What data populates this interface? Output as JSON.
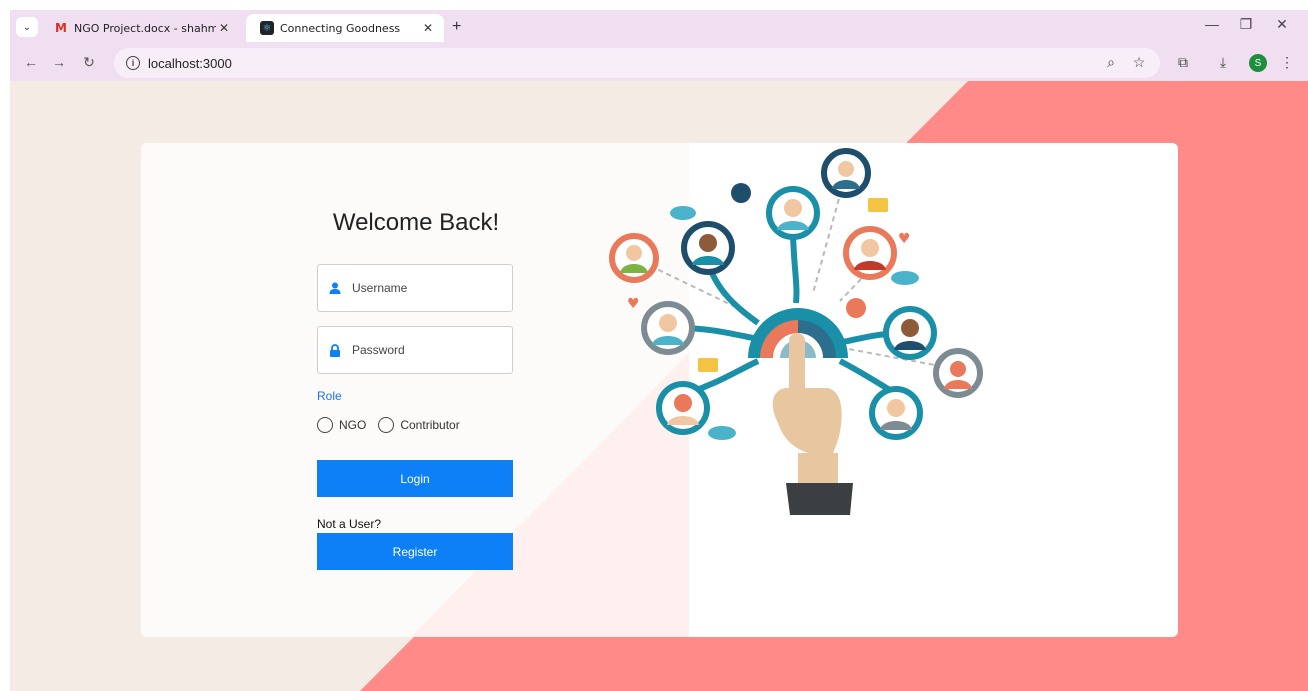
{
  "browser": {
    "tabs": [
      {
        "title": "NGO Project.docx - shahmiloni…",
        "active": false,
        "favicon": "gmail-icon"
      },
      {
        "title": "Connecting Goodness",
        "active": true,
        "favicon": "react-icon"
      }
    ],
    "url": "localhost:3000",
    "profile_initial": "S"
  },
  "login": {
    "heading": "Welcome Back!",
    "username_placeholder": "Username",
    "password_placeholder": "Password",
    "role_label": "Role",
    "roles": [
      "NGO",
      "Contributor"
    ],
    "login_label": "Login",
    "not_user_text": "Not a User?",
    "register_label": "Register"
  },
  "colors": {
    "accent": "#0d7ff7",
    "page_bg": "#f3ebe4",
    "coral": "#ff8a87"
  }
}
